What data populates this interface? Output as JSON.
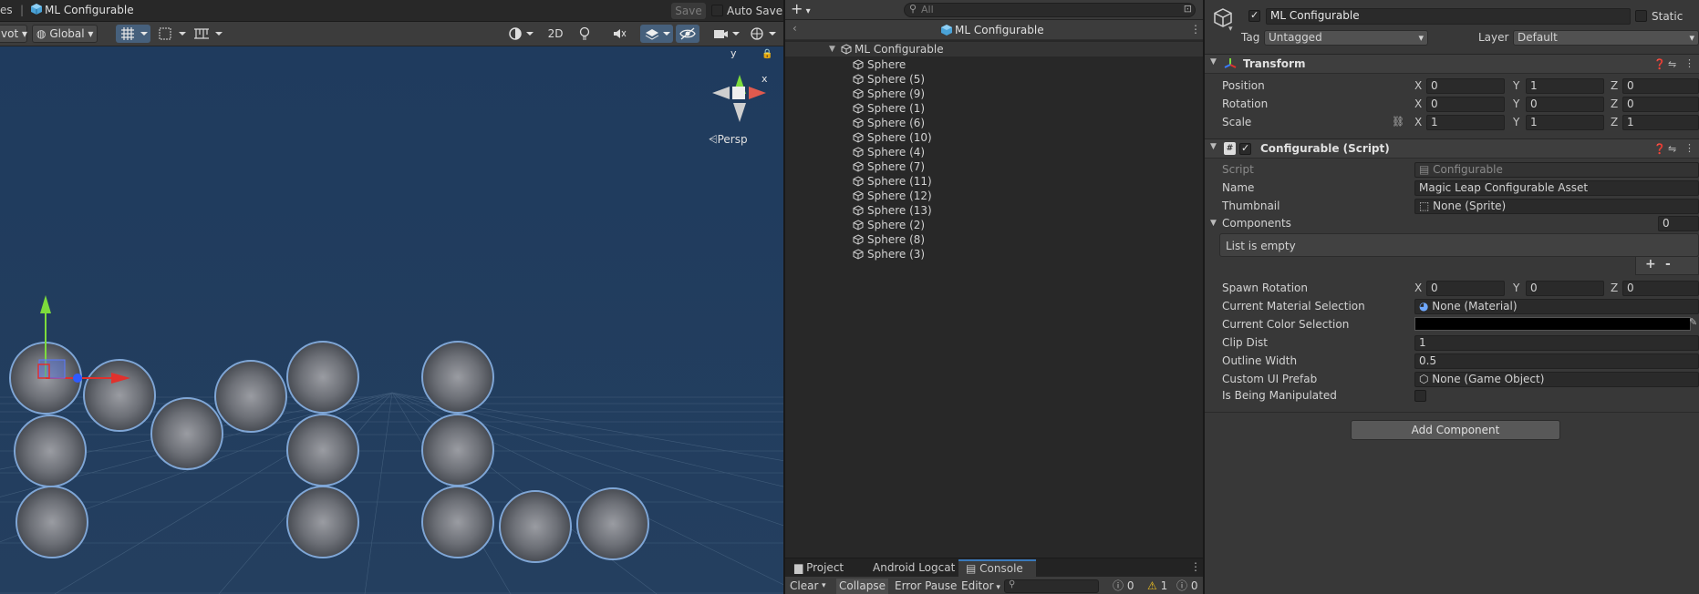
{
  "scene": {
    "tab_left_fragment": "es",
    "tab_title": "ML Configurable",
    "save_label": "Save",
    "auto_save_label": "Auto Save",
    "pivot_fragment": "vot",
    "global_label": "Global",
    "mode_2d_label": "2D",
    "gizmo_y": "y",
    "gizmo_x": "x",
    "persp_label": "Persp"
  },
  "hierarchy": {
    "add_label": "+",
    "search_placeholder": "All",
    "scene_title": "ML Configurable",
    "root_label": "ML Configurable",
    "items": [
      "Sphere",
      "Sphere (5)",
      "Sphere (9)",
      "Sphere (1)",
      "Sphere (6)",
      "Sphere (10)",
      "Sphere (4)",
      "Sphere (7)",
      "Sphere (11)",
      "Sphere (12)",
      "Sphere (13)",
      "Sphere (2)",
      "Sphere (8)",
      "Sphere (3)"
    ]
  },
  "console": {
    "tabs": [
      "Project",
      "Android Logcat",
      "Console"
    ],
    "clear_label": "Clear",
    "collapse_label": "Collapse",
    "error_pause_label": "Error Pause",
    "editor_label": "Editor",
    "count_info": "0",
    "count_warn": "1",
    "count_error": "0"
  },
  "inspector": {
    "object_name": "ML Configurable",
    "static_label": "Static",
    "tag_label": "Tag",
    "tag_value": "Untagged",
    "layer_label": "Layer",
    "layer_value": "Default",
    "transform": {
      "title": "Transform",
      "position_label": "Position",
      "rotation_label": "Rotation",
      "scale_label": "Scale",
      "position": {
        "x": "0",
        "y": "1",
        "z": "0"
      },
      "rotation": {
        "x": "0",
        "y": "0",
        "z": "0"
      },
      "scale": {
        "x": "1",
        "y": "1",
        "z": "1"
      }
    },
    "script": {
      "title": "Configurable (Script)",
      "script_label": "Script",
      "script_value": "Configurable",
      "name_label": "Name",
      "name_value": "Magic Leap Configurable Asset",
      "thumbnail_label": "Thumbnail",
      "thumbnail_value": "None (Sprite)",
      "components_label": "Components",
      "components_count": "0",
      "list_empty": "List is empty",
      "plus": "+",
      "minus": "-",
      "spawn_rotation_label": "Spawn Rotation",
      "spawn_rotation": {
        "x": "0",
        "y": "0",
        "z": "0"
      },
      "material_label": "Current Material Selection",
      "material_value": "None (Material)",
      "color_label": "Current Color Selection",
      "color_value": "#000000",
      "clip_label": "Clip Dist",
      "clip_value": "1",
      "outline_label": "Outline Width",
      "outline_value": "0.5",
      "prefab_label": "Custom UI Prefab",
      "prefab_value": "None (Game Object)",
      "manip_label": "Is Being Manipulated"
    },
    "add_component_label": "Add Component"
  },
  "axes_labels": {
    "x": "X",
    "y": "Y",
    "z": "Z"
  }
}
